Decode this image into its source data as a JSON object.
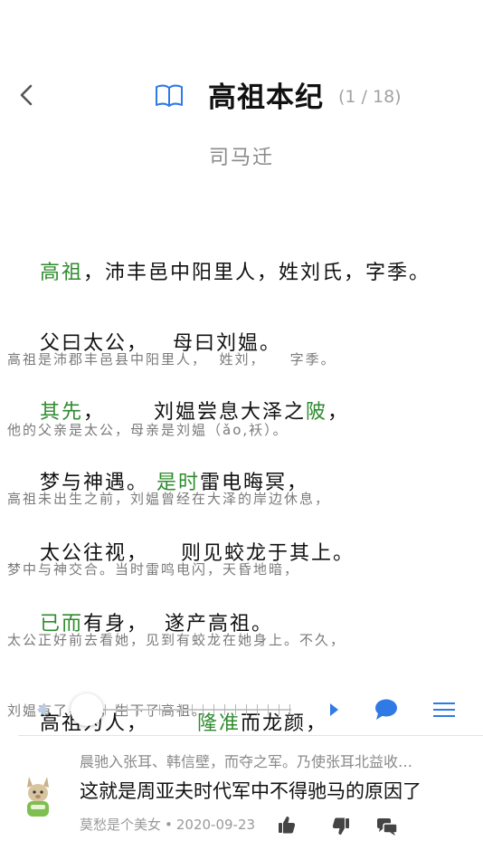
{
  "header": {
    "title": "高祖本纪",
    "counter": "(1 / 18)",
    "author": "司马迁"
  },
  "verses": [
    {
      "orig": [
        {
          "text": "高祖",
          "hl": true
        },
        {
          "text": "，沛丰邑中阳里人，姓刘氏，字季。",
          "hl": false
        }
      ],
      "trans": "高祖是沛郡丰邑县中阳里人，  姓刘，    字季。"
    },
    {
      "orig": [
        {
          "text": "父曰太公，   母曰刘媪。",
          "hl": false
        }
      ],
      "trans": "他的父亲是太公，母亲是刘媪（ǎo,袄）。"
    },
    {
      "orig": [
        {
          "text": "其先",
          "hl": true
        },
        {
          "text": "，      刘媪尝息大泽之",
          "hl": false
        },
        {
          "text": "陂",
          "hl": true
        },
        {
          "text": "，",
          "hl": false
        }
      ],
      "trans": "高祖未出生之前，刘媪曾经在大泽的岸边休息，"
    },
    {
      "orig": [
        {
          "text": "梦与神遇。 ",
          "hl": false
        },
        {
          "text": "是时",
          "hl": true
        },
        {
          "text": "雷电晦冥，",
          "hl": false
        }
      ],
      "trans": "梦中与神交合。当时雷鸣电闪，天昏地暗，"
    },
    {
      "orig": [
        {
          "text": "太公往视，    则见蛟龙于其上。",
          "hl": false
        }
      ],
      "trans": "太公正好前去看她，见到有蛟龙在她身上。不久，"
    },
    {
      "orig": [
        {
          "text": "已而",
          "hl": true
        },
        {
          "text": "有身，  遂产高祖。",
          "hl": false
        }
      ],
      "trans": "刘媪有了身孕，生下了高祖。"
    },
    {
      "orig": [
        {
          "text": "高祖为人，      ",
          "hl": false
        },
        {
          "text": "隆准",
          "hl": true
        },
        {
          "text": "而龙颜，",
          "hl": false
        }
      ],
      "trans": ""
    }
  ],
  "controls": {
    "slider_position": 0,
    "tick_count": 18
  },
  "comment": {
    "quote": "晨驰入张耳、韩信壁，而夺之军。乃使张耳北益收…",
    "text": "这就是周亚夫时代军中不得驰马的原因了",
    "user": "莫愁是个美女",
    "separator": "•",
    "date": "2020-09-23"
  },
  "colors": {
    "accent": "#2f7ae5",
    "highlight": "#2e8b2e"
  },
  "icons": {
    "back": "chevron-left-icon",
    "book": "book-icon",
    "prev": "triangle-left-icon",
    "next": "triangle-right-icon",
    "comment": "speech-bubble-icon",
    "menu": "hamburger-menu-icon",
    "like": "thumbs-up-icon",
    "dislike": "thumbs-down-icon",
    "reply": "reply-bubbles-icon"
  }
}
